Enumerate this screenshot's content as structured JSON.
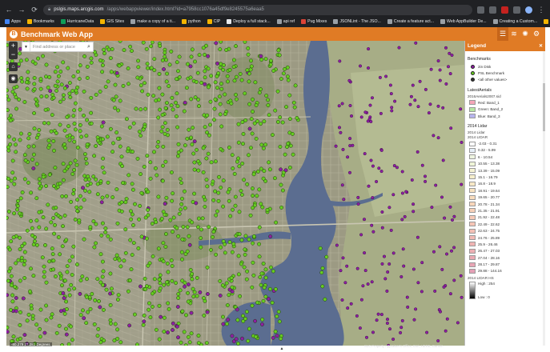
{
  "browser": {
    "nav_back": "←",
    "nav_forward": "→",
    "reload": "⟳",
    "url_host": "pslgis.maps.arcgis.com",
    "url_path": "/apps/webappviewer/index.html?id=a7958cc1076a45df9e8245575a6eaa5",
    "bookmarks": [
      {
        "label": "Apps",
        "color": "#4285f4"
      },
      {
        "label": "Bookmarks",
        "color": "#f4b400"
      },
      {
        "label": "HurricaneData",
        "color": "#0f9d58"
      },
      {
        "label": "GIS Sites",
        "color": "#f4b400"
      },
      {
        "label": "make a copy of a ti...",
        "color": "#9aa0a6"
      },
      {
        "label": "python",
        "color": "#f4b400"
      },
      {
        "label": "CIP",
        "color": "#f4b400"
      },
      {
        "label": "Deploy a full stack...",
        "color": "#e8eaed"
      },
      {
        "label": "api ref",
        "color": "#9aa0a6"
      },
      {
        "label": "Pug Mixes",
        "color": "#db4437"
      },
      {
        "label": "JSONLint - The JSO...",
        "color": "#9aa0a6"
      },
      {
        "label": "Create a feature act...",
        "color": "#9aa0a6"
      },
      {
        "label": "Web AppBuilder De...",
        "color": "#9aa0a6"
      },
      {
        "label": "Creating a Custom...",
        "color": "#9aa0a6"
      }
    ],
    "other_bookmarks": "Other bookmarks"
  },
  "app": {
    "title": "Benchmark Web App",
    "accent": "#e07b25",
    "widgets": [
      {
        "icon": "legend-icon",
        "glyph": "☰"
      },
      {
        "icon": "layers-icon",
        "glyph": "≋"
      },
      {
        "icon": "basemap-icon",
        "glyph": "✺"
      },
      {
        "icon": "settings-icon",
        "glyph": "⚙"
      }
    ]
  },
  "map": {
    "search_placeholder": "Find address or place",
    "zoom_in": "+",
    "zoom_out": "−",
    "home": "⌂",
    "locate": "◉",
    "coordinates": "-80.279 27.281 Degrees",
    "attribution": "SLC Property Appraiser's Office, Esri, HERE, Garmin",
    "collapse": "▲"
  },
  "legend": {
    "title": "Legend",
    "close": "✕",
    "benchmarks": {
      "layer": "Benchmarks",
      "items": [
        {
          "label": "2in Disk",
          "color": "#8e1ea3"
        },
        {
          "label": "PSL Benchmark",
          "color": "#66cc22"
        },
        {
          "label": "<all other values>",
          "color": "#333333"
        }
      ]
    },
    "aerials": {
      "layer": "LatestAerials",
      "sublayer": "2016Aerials2007.sid",
      "items": [
        {
          "label": "Red: Band_1",
          "color": "#f4a6b8"
        },
        {
          "label": "Green: Band_2",
          "color": "#b6e7a2"
        },
        {
          "label": "Blue: Band_3",
          "color": "#b7b5ee"
        }
      ]
    },
    "lidar": {
      "layer": "2014 Lidar",
      "sublayer": "2014 Lidar",
      "sublayer2": "2014 LIDAR",
      "items": [
        {
          "label": "-2.03 - 0.31",
          "color": "#ffffff"
        },
        {
          "label": "0.32 - 5.99",
          "color": "#e6eff8"
        },
        {
          "label": "6 - 10.54",
          "color": "#eef4e0"
        },
        {
          "label": "10.55 - 13.38",
          "color": "#f0f5d8"
        },
        {
          "label": "13.39 - 15.09",
          "color": "#f5f2d2"
        },
        {
          "label": "15.1 - 16.79",
          "color": "#f6eecb"
        },
        {
          "label": "16.8 - 18.9",
          "color": "#f7e8c6"
        },
        {
          "label": "18.91 - 19.64",
          "color": "#f8e3c1"
        },
        {
          "label": "19.65 - 20.77",
          "color": "#f8dcbd"
        },
        {
          "label": "20.78 - 21.34",
          "color": "#f8d6ba"
        },
        {
          "label": "21.35 - 21.91",
          "color": "#f7d0b8"
        },
        {
          "label": "21.92 - 22.48",
          "color": "#f6cab7"
        },
        {
          "label": "22.49 - 22.62",
          "color": "#f5c5b6"
        },
        {
          "label": "22.63 - 24.75",
          "color": "#f3c0b5"
        },
        {
          "label": "24.76 - 25.89",
          "color": "#f1bab4"
        },
        {
          "label": "25.9 - 26.46",
          "color": "#efb4b3"
        },
        {
          "label": "26.47 - 27.03",
          "color": "#ecafb3"
        },
        {
          "label": "27.04 - 28.16",
          "color": "#eaaab3"
        },
        {
          "label": "28.17 - 29.87",
          "color": "#e7a5b4"
        },
        {
          "label": "29.88 - 144.16",
          "color": "#e4a0b5"
        }
      ],
      "hs_label": "2014 LIDAR HS",
      "hs_high": "High : 254",
      "hs_low": "Low : 0"
    }
  }
}
